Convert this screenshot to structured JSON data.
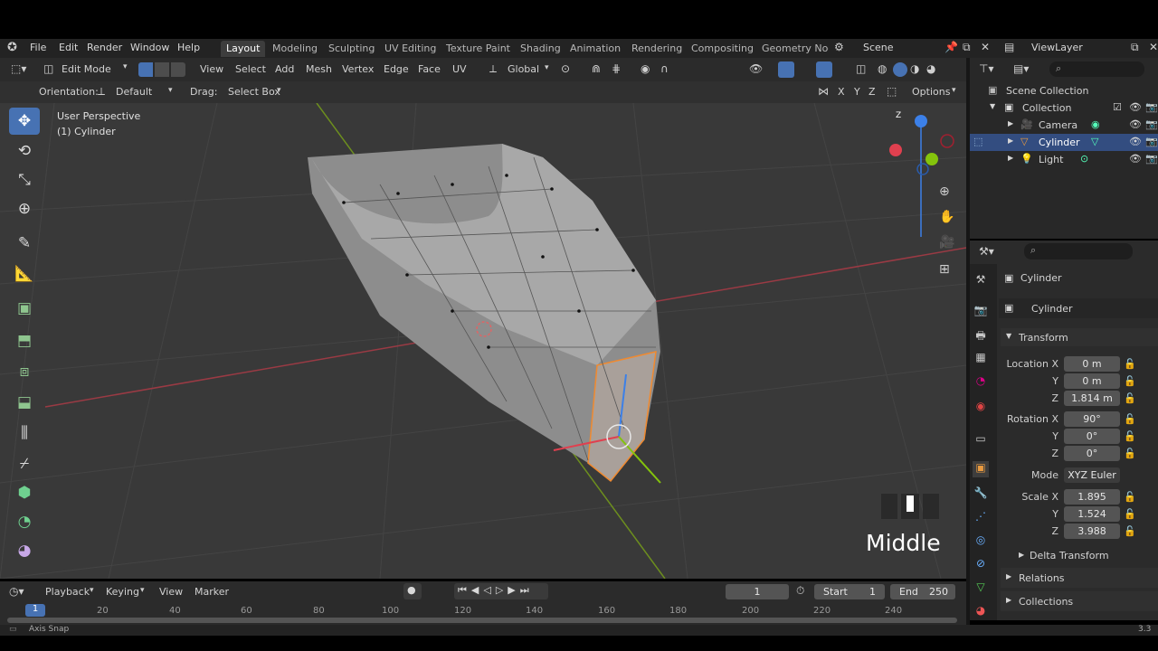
{
  "menu": {
    "file": "File",
    "edit": "Edit",
    "render": "Render",
    "window": "Window",
    "help": "Help"
  },
  "workspaces": [
    "Layout",
    "Modeling",
    "Sculpting",
    "UV Editing",
    "Texture Paint",
    "Shading",
    "Animation",
    "Rendering",
    "Compositing",
    "Geometry Noc"
  ],
  "scene": {
    "label": "Scene",
    "view_layer": "ViewLayer"
  },
  "header": {
    "mode": "Edit Mode",
    "menus": [
      "View",
      "Select",
      "Add",
      "Mesh",
      "Vertex",
      "Edge",
      "Face",
      "UV"
    ],
    "transform": "Global",
    "orientation_label": "Orientation:",
    "orientation_value": "Default",
    "drag_label": "Drag:",
    "drag_value": "Select Box",
    "axes": [
      "X",
      "Y",
      "Z"
    ],
    "options": "Options"
  },
  "viewport": {
    "perspective": "User Perspective",
    "object": "(1) Cylinder",
    "overlay_key": "Middle",
    "gizmo_axes": [
      "X",
      "Y",
      "Z"
    ]
  },
  "outliner": {
    "root": "Scene Collection",
    "collection": "Collection",
    "items": [
      {
        "label": "Camera",
        "icon": "camera-icon",
        "selected": false
      },
      {
        "label": "Cylinder",
        "icon": "mesh-icon",
        "selected": true
      },
      {
        "label": "Light",
        "icon": "light-icon",
        "selected": false
      }
    ]
  },
  "properties": {
    "object_name": "Cylinder",
    "data_name": "Cylinder",
    "transform_header": "Transform",
    "location": {
      "label": "Location X",
      "x": "0 m",
      "y": "0 m",
      "z": "1.814 m"
    },
    "rotation": {
      "label": "Rotation X",
      "x": "90°",
      "y": "0°",
      "z": "0°"
    },
    "mode_label": "Mode",
    "mode_value": "XYZ Euler",
    "scale": {
      "label": "Scale X",
      "x": "1.895",
      "y": "1.524",
      "z": "3.988"
    },
    "axis_y": "Y",
    "axis_z": "Z",
    "delta": "Delta Transform",
    "relations": "Relations",
    "collections": "Collections"
  },
  "timeline": {
    "playback": "Playback",
    "keying": "Keying",
    "view": "View",
    "marker": "Marker",
    "current_frame": "1",
    "start_label": "Start",
    "start": "1",
    "end_label": "End",
    "end": "250",
    "ticks": [
      "1",
      "20",
      "40",
      "60",
      "80",
      "100",
      "120",
      "140",
      "160",
      "180",
      "200",
      "220",
      "240"
    ]
  },
  "status": {
    "left": "Axis Snap",
    "right": "3.3"
  },
  "colors": {
    "accent": "#4772b3",
    "selected_row": "#334d80",
    "x_axis": "#e0404f",
    "y_axis": "#84c40c",
    "z_axis": "#3c80e8",
    "selection": "#f08a30"
  }
}
